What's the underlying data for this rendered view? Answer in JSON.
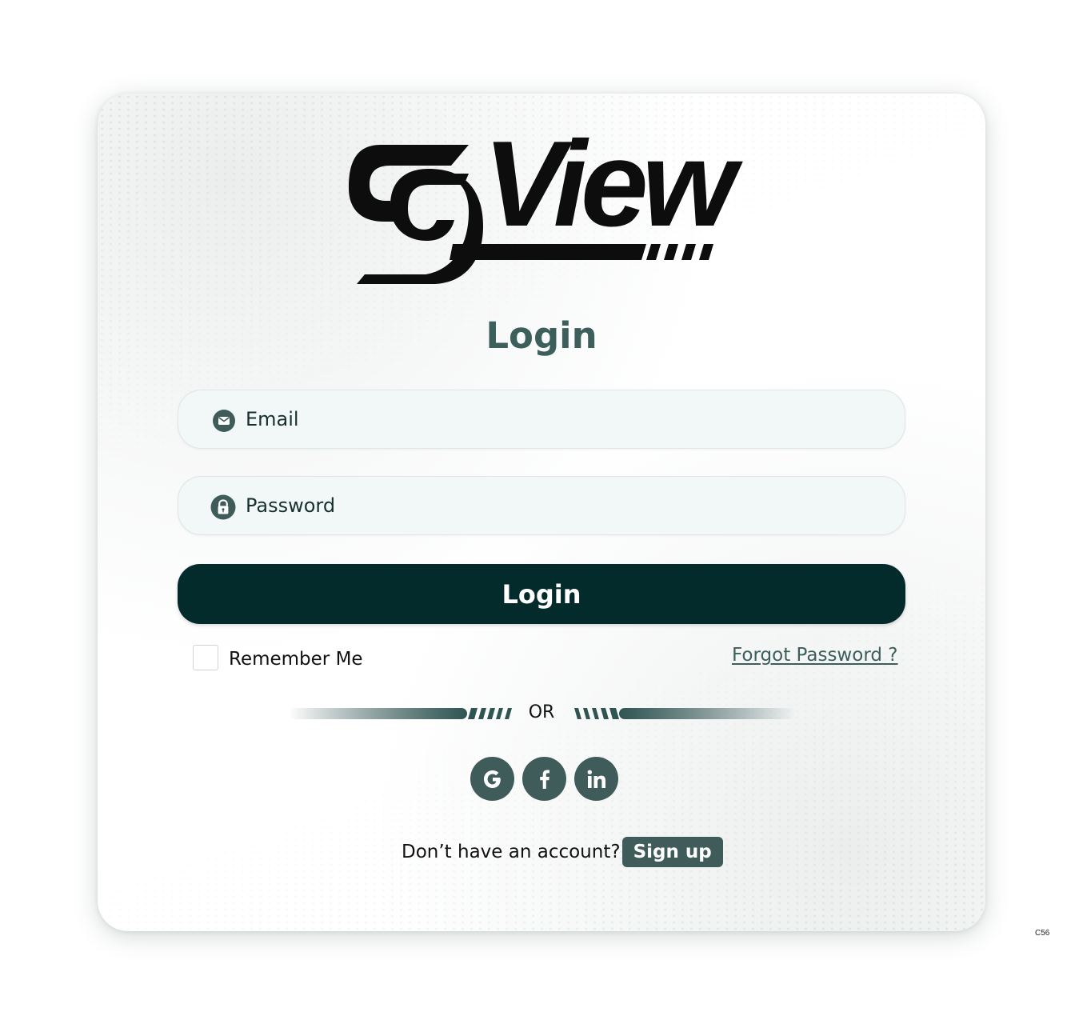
{
  "brand": {
    "logo_text": "View",
    "logo_mark": "SG"
  },
  "login": {
    "title": "Login",
    "email_placeholder": "Email",
    "password_placeholder": "Password",
    "button_label": "Login",
    "remember_label": "Remember Me",
    "forgot_label": "Forgot Password ?",
    "or_label": "OR"
  },
  "social": [
    {
      "name": "google-icon",
      "glyph": "G"
    },
    {
      "name": "facebook-icon",
      "glyph": "f"
    },
    {
      "name": "linkedin-icon",
      "glyph": "in"
    }
  ],
  "signup": {
    "prompt": "Don’t have an account?",
    "button_label": "Sign up"
  },
  "footer": {
    "code": "C56"
  },
  "colors": {
    "primary_dark": "#042b2b",
    "accent": "#3f5c5a",
    "title": "#3c5f5c",
    "field_bg": "#f2f7f7"
  }
}
